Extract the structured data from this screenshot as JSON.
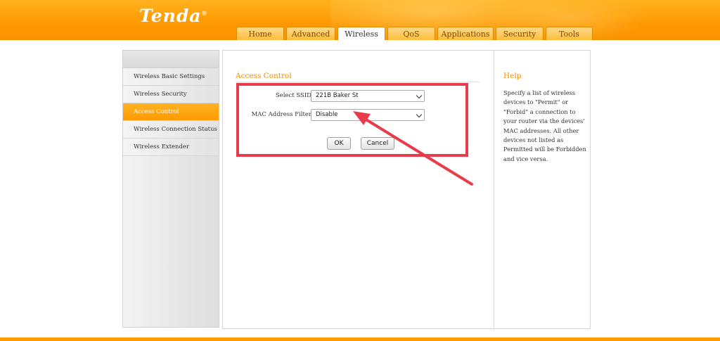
{
  "brand": {
    "logo_text": "Tenda",
    "logo_mark": "®"
  },
  "nav": {
    "tabs": [
      {
        "label": "Home",
        "active": false
      },
      {
        "label": "Advanced",
        "active": false
      },
      {
        "label": "Wireless",
        "active": true
      },
      {
        "label": "QoS",
        "active": false
      },
      {
        "label": "Applications",
        "active": false
      },
      {
        "label": "Security",
        "active": false
      },
      {
        "label": "Tools",
        "active": false
      }
    ]
  },
  "sidebar": {
    "items": [
      {
        "label": "Wireless Basic Settings",
        "active": false
      },
      {
        "label": "Wireless Security",
        "active": false
      },
      {
        "label": "Access Control",
        "active": true
      },
      {
        "label": "Wireless Connection Status",
        "active": false
      },
      {
        "label": "Wireless Extender",
        "active": false
      }
    ]
  },
  "content": {
    "title": "Access Control",
    "ssid_label": "Select SSID",
    "ssid_value": "221B Baker St",
    "mac_label": "MAC Address Filter",
    "mac_value": "Disable",
    "ok_label": "OK",
    "cancel_label": "Cancel"
  },
  "help": {
    "title": "Help",
    "text": "Specify a list of wireless devices to \"Permit\" or \"Forbid\" a connection to your router via the devices' MAC addresses. All other devices not listed as Permitted will be Forbidden and vice versa."
  },
  "colors": {
    "brand_orange": "#ff9800",
    "accent_text": "#f08c00",
    "annotation_red": "#e93c4a"
  }
}
